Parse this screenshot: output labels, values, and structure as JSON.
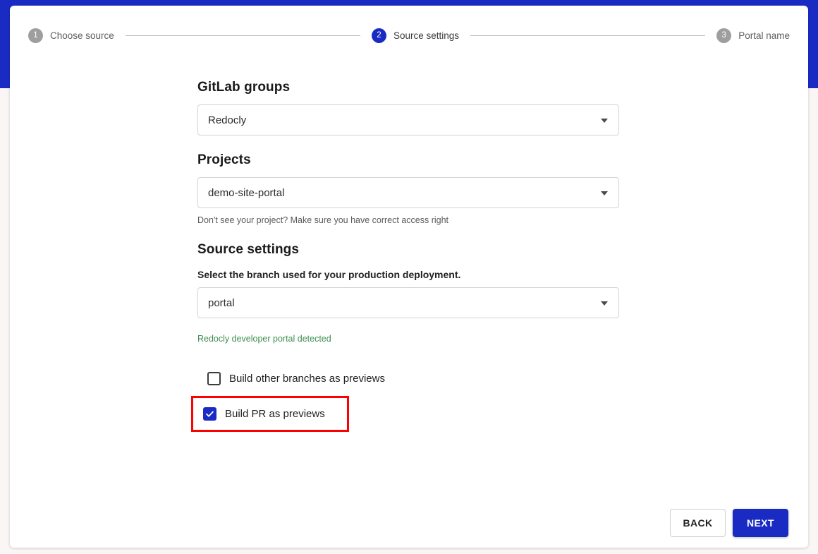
{
  "theme": {
    "brand_blue": "#1a2bc4",
    "page_background": "#fbf6f6",
    "success_green": "#3f8e4f",
    "highlight_red": "#ff0000"
  },
  "stepper": {
    "steps": [
      {
        "number": "1",
        "label": "Choose source",
        "state": "inactive"
      },
      {
        "number": "2",
        "label": "Source settings",
        "state": "active"
      },
      {
        "number": "3",
        "label": "Portal name",
        "state": "inactive"
      }
    ]
  },
  "form": {
    "gitlab_groups": {
      "title": "GitLab groups",
      "value": "Redocly",
      "caret_icon": "chevron-down-icon"
    },
    "projects": {
      "title": "Projects",
      "value": "demo-site-portal",
      "caret_icon": "chevron-down-icon",
      "hint": "Don't see your project? Make sure you have correct access right"
    },
    "source_settings": {
      "title": "Source settings",
      "branch_label": "Select the branch used for your production deployment.",
      "branch_value": "portal",
      "caret_icon": "chevron-down-icon",
      "detected_message": "Redocly developer portal detected"
    },
    "checkboxes": [
      {
        "label": "Build other branches as previews",
        "checked": false,
        "highlighted": false
      },
      {
        "label": "Build PR as previews",
        "checked": true,
        "highlighted": true
      }
    ]
  },
  "footer": {
    "back_label": "BACK",
    "next_label": "NEXT"
  }
}
